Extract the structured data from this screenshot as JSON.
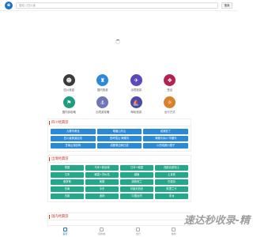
{
  "header": {
    "logo_glyph": "e",
    "search_placeholder": "搜站 / 四川省",
    "search_button": "搜索"
  },
  "icons": [
    {
      "label": "四川旅游",
      "glyph": "☻",
      "color": "#3b3b3b",
      "name": "panda-icon"
    },
    {
      "label": "国内旅游",
      "glyph": "♜",
      "color": "#2b8ad8",
      "name": "landmark-icon"
    },
    {
      "label": "出境旅游",
      "glyph": "✈",
      "color": "#5a49b8",
      "name": "plane-icon"
    },
    {
      "label": "签证",
      "glyph": "❖",
      "color": "#b2244f",
      "name": "visa-icon"
    },
    {
      "label": "国内游攻略",
      "glyph": "⚑",
      "color": "#1f9c7e",
      "name": "guide-icon"
    },
    {
      "label": "出境游攻略",
      "glyph": "⚓",
      "color": "#6f76b6",
      "name": "cruise-icon"
    },
    {
      "label": "邮轮旅游",
      "glyph": "⛵",
      "color": "#4a4aa8",
      "name": "ship-icon"
    },
    {
      "label": "出行方式",
      "glyph": "☼",
      "color": "#d9812a",
      "name": "travel-mode-icon"
    }
  ],
  "sections": [
    {
      "title": "四川经典游",
      "items": [
        "九寨沟黄龙",
        "峨眉山乐山",
        "稻城亚丁",
        "四川最美景区线",
        "西岭雪山·海螺沟",
        "海螺沟冰川·毕棚沟",
        "甘南山湖自驾",
        "成都周边两日游",
        "川西成都小圈子"
      ]
    },
    {
      "title": "出境经典游",
      "items": [
        "泰国",
        "马来+新加坡",
        "日本+韩国",
        "西欧北欧瑞士",
        "日本",
        "韩国+济州岛",
        "越南",
        "土耳其",
        "俄罗斯",
        "美国",
        "澳新西兰",
        "巴厘岛",
        "东南",
        "中东",
        "印度尼西亚",
        "斯里兰卡",
        "东欧",
        "迪拜",
        "中国台湾",
        "非洲"
      ]
    },
    {
      "title": "国内经典游"
    }
  ],
  "bottomnav": [
    "首页",
    "目的地",
    "出行",
    "我的"
  ],
  "watermark": "速达秒收录-精"
}
